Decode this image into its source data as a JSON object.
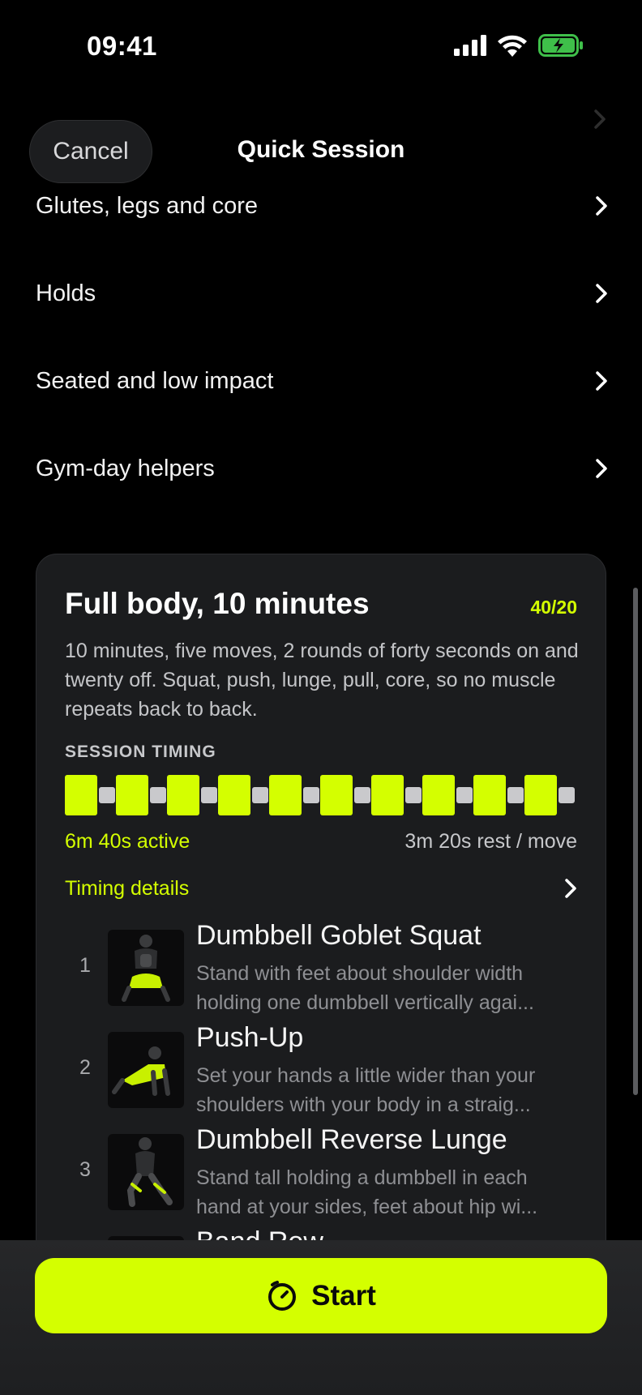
{
  "status_bar": {
    "time": "09:41"
  },
  "nav": {
    "cancel_label": "Cancel",
    "title": "Quick Session"
  },
  "categories": [
    {
      "label": "Glutes, legs and core"
    },
    {
      "label": "Holds"
    },
    {
      "label": "Seated and low impact"
    },
    {
      "label": "Gym-day helpers"
    }
  ],
  "session": {
    "title": "Full body, 10 minutes",
    "badge": "40/20",
    "description": "10 minutes, five moves, 2 rounds of forty seconds on and twenty off. Squat, push, lunge, pull, core, so no muscle repeats back to back.",
    "timing_label": "SESSION TIMING",
    "active_summary": "6m 40s active",
    "rest_summary": "3m 20s rest / move",
    "timing_details_label": "Timing details",
    "exercises": [
      {
        "index": "1",
        "name": "Dumbbell Goblet Squat",
        "desc_line1": "Stand with feet about shoulder width",
        "desc_line2": "holding one dumbbell vertically agai..."
      },
      {
        "index": "2",
        "name": "Push-Up",
        "desc_line1": "Set your hands a little wider than your",
        "desc_line2": "shoulders with your body in a straig..."
      },
      {
        "index": "3",
        "name": "Dumbbell Reverse Lunge",
        "desc_line1": "Stand tall holding a dumbbell in each",
        "desc_line2": "hand at your sides, feet about hip wi..."
      },
      {
        "index": "",
        "name": "Band Row",
        "desc_line1": "",
        "desc_line2": ""
      }
    ]
  },
  "start_button": {
    "label": "Start"
  },
  "colors": {
    "accent": "#d4ff00",
    "background": "#000000",
    "card": "#1b1c1e"
  }
}
